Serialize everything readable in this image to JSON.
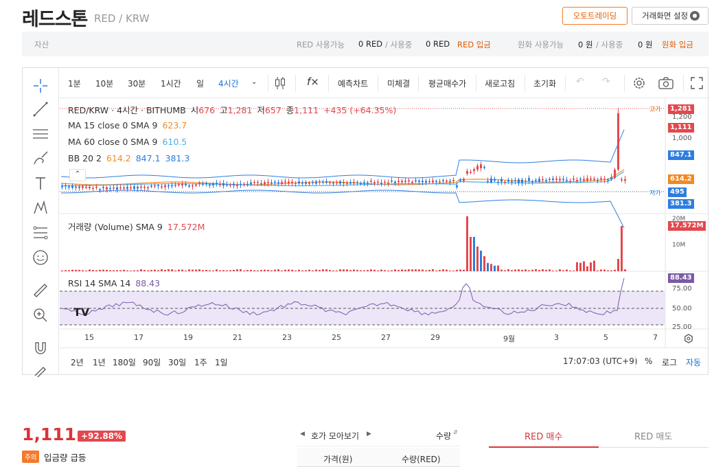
{
  "header": {
    "coin_name": "레드스톤",
    "pair": "RED / KRW",
    "auto_trading_button": "오토트레이딩",
    "screen_settings_button": "거래화면 설정"
  },
  "asset_bar": {
    "label": "자산",
    "red_available_label": "RED 사용가능",
    "red_available": "0 RED",
    "red_in_use_label": "/ 사용중",
    "red_in_use": "0 RED",
    "red_deposit": "RED 입금",
    "krw_available_label": "원화 사용가능",
    "krw_available": "0 원",
    "krw_in_use_label": "/ 사용중",
    "krw_in_use": "0 원",
    "krw_deposit": "원화 입금"
  },
  "toolbar": {
    "intervals": [
      "1분",
      "10분",
      "30분",
      "1시간",
      "일",
      "4시간"
    ],
    "active_interval": "4시간",
    "fx_label": "f×",
    "prediction_chart": "예측차트",
    "unfilled": "미체결",
    "avg_buy_price": "평균매수가",
    "refresh": "새로고침",
    "reset": "초기화"
  },
  "legend": {
    "pair_line": "RED/KRW · 4시간 · BITHUMB",
    "open_label": "시",
    "open": "676",
    "high_label": "고",
    "high": "1,281",
    "low_label": "저",
    "low": "657",
    "close_label": "종",
    "close": "1,111",
    "change": "+435 (+64.35%)",
    "ma15_label": "MA 15 close 0 SMA 9",
    "ma15_value": "623.7",
    "ma60_label": "MA 60 close 0 SMA 9",
    "ma60_value": "610.5",
    "bb_label": "BB 20 2",
    "bb_mid": "614.2",
    "bb_upper": "847.1",
    "bb_lower": "381.3",
    "volume_label": "거래량 (Volume) SMA 9",
    "volume_value": "17.572M",
    "rsi_label": "RSI 14 SMA 14",
    "rsi_value": "88.43"
  },
  "price_axis": {
    "ticks": [
      "1,200",
      "1,000"
    ],
    "high_tag": "고가",
    "low_tag": "저가",
    "badges": {
      "high": "1,281",
      "close": "1,111",
      "bb_upper": "847.1",
      "bb_mid": "614.2",
      "low": "495",
      "bb_lower": "381.3"
    },
    "volume_ticks": [
      "20M",
      "10M"
    ],
    "volume_badge": "17.572M",
    "rsi_ticks": [
      "75.00",
      "50.00",
      "25.00"
    ],
    "rsi_badge": "88.43"
  },
  "time_axis": [
    "15",
    "17",
    "19",
    "21",
    "23",
    "25",
    "27",
    "29",
    "9월",
    "3",
    "5",
    "7"
  ],
  "bottom_bar": {
    "ranges": [
      "2년",
      "1년",
      "180일",
      "90일",
      "30일",
      "1주",
      "1일"
    ],
    "clock": "17:07:03 (UTC+9)",
    "percent": "%",
    "log": "로그",
    "auto": "자동"
  },
  "price_panel": {
    "current_price": "1,111",
    "change_rate": "+92.88%",
    "warning_badge": "주의",
    "warning_text": "입금량 급등"
  },
  "orderbook": {
    "view_label": "호가 모아보기",
    "qty_sort": "수량",
    "col_price": "가격(원)",
    "col_qty": "수량(RED)"
  },
  "trade_tabs": {
    "buy": "RED 매수",
    "sell": "RED 매도"
  },
  "colors": {
    "up": "#e2484d",
    "down": "#2d7de0",
    "accent": "#e55b00",
    "ma15": "#f08a24",
    "ma60": "#4ab0e8",
    "rsi": "#7b5aa6"
  },
  "chart_data": {
    "type": "candlestick",
    "interval": "4시간",
    "exchange": "BITHUMB",
    "ohlc_last": {
      "open": 676,
      "high": 1281,
      "low": 657,
      "close": 1111
    },
    "period_high": 1281,
    "period_low": 495,
    "bollinger": {
      "period": 20,
      "stddev": 2,
      "mid": 614.2,
      "upper": 847.1,
      "lower": 381.3
    },
    "ma15": 623.7,
    "ma60": 610.5,
    "volume_last": "17.572M",
    "rsi_last": 88.43,
    "rsi_levels": [
      75,
      50,
      25
    ]
  }
}
